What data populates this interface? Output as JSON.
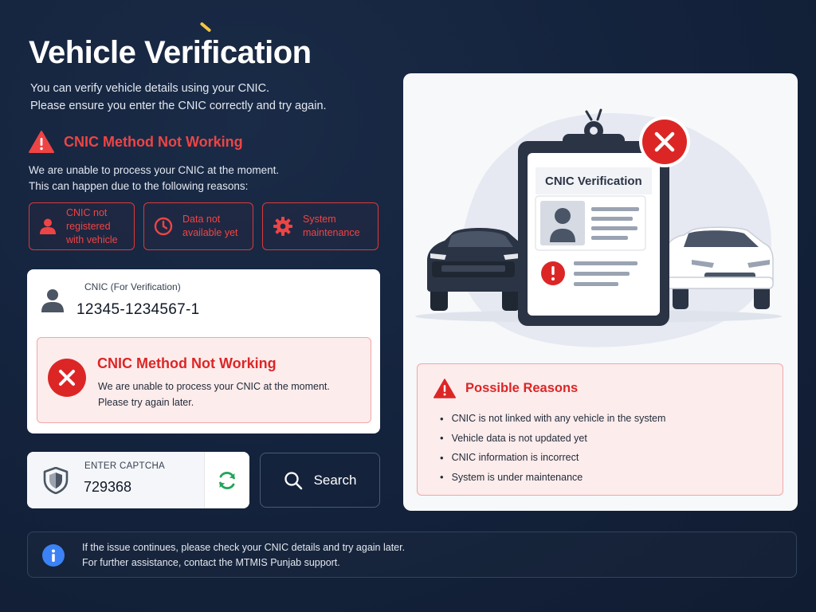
{
  "page": {
    "title": "Vehicle Verification",
    "subtitle_lines": [
      "You can verify vehicle details using your CNIC.",
      "Please ensure you enter the CNIC correctly and try again."
    ]
  },
  "warning": {
    "heading": "CNIC Method Not Working",
    "desc_lines": [
      "We are unable to process your CNIC at the moment.",
      "This can happen due to the following reasons:"
    ],
    "reasons": [
      {
        "icon": "person-icon",
        "lines": [
          "CNIC not",
          "registered",
          "with vehicle"
        ]
      },
      {
        "icon": "clock-icon",
        "lines": [
          "Data not",
          "available yet"
        ]
      },
      {
        "icon": "gear-icon",
        "lines": [
          "System",
          "maintenance"
        ]
      }
    ]
  },
  "cnic_card": {
    "label": "CNIC (For Verification)",
    "value": "12345-1234567-1",
    "error": {
      "title": "CNIC Method Not Working",
      "lines": [
        "We are unable to process your CNIC at the moment.",
        "Please try again later."
      ]
    }
  },
  "captcha": {
    "label": "ENTER CAPTCHA",
    "value": "729368"
  },
  "search": {
    "label": "Search"
  },
  "illustration": {
    "card_title": "CNIC Verification"
  },
  "possible_reasons": {
    "heading": "Possible Reasons",
    "items": [
      "CNIC is not linked with any vehicle in the system",
      "Vehicle data is not updated yet",
      "CNIC information is incorrect",
      "System is under maintenance"
    ]
  },
  "info": {
    "lines": [
      "If the issue continues, please check your CNIC details and try again later.",
      "For further assistance, contact the MTMIS Punjab support."
    ]
  },
  "colors": {
    "background": "#13213a",
    "danger": "#ef4444",
    "danger_dark": "#dc2626",
    "error_bg": "#fdecec",
    "success": "#22a55a",
    "info": "#3b82f6"
  }
}
